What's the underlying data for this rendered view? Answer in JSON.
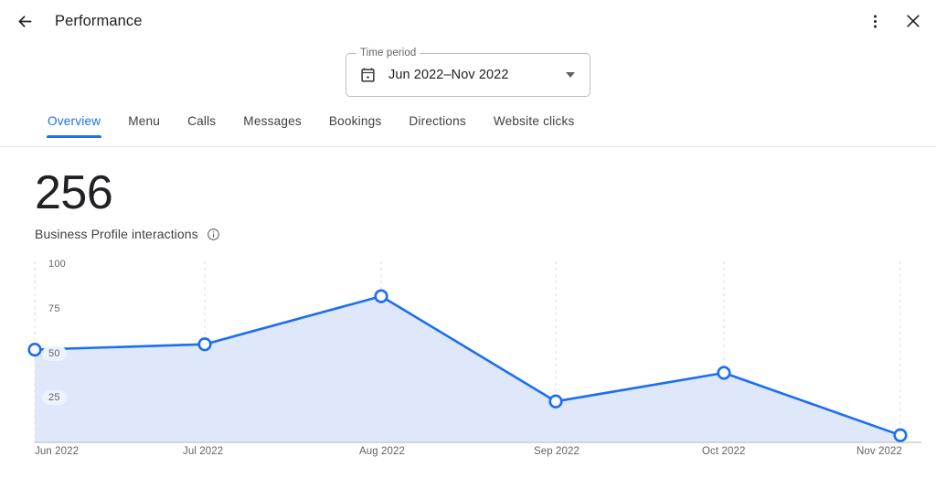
{
  "header": {
    "back_icon": "arrow-left-icon",
    "title": "Performance",
    "more_icon": "more-vertical-icon",
    "close_icon": "close-icon"
  },
  "time_period": {
    "legend": "Time period",
    "value": "Jun 2022–Nov 2022",
    "calendar_icon": "calendar-icon",
    "dropdown_icon": "chevron-down-icon"
  },
  "tabs": [
    {
      "label": "Overview",
      "active": true
    },
    {
      "label": "Menu",
      "active": false
    },
    {
      "label": "Calls",
      "active": false
    },
    {
      "label": "Messages",
      "active": false
    },
    {
      "label": "Bookings",
      "active": false
    },
    {
      "label": "Directions",
      "active": false
    },
    {
      "label": "Website clicks",
      "active": false
    }
  ],
  "metric": {
    "value": "256",
    "label": "Business Profile interactions",
    "info_icon": "info-circle-icon"
  },
  "colors": {
    "accent": "#1a73e8",
    "line": "#1b6ef3",
    "fill": "#dfe8fb",
    "grid": "#dadce0",
    "text_secondary": "#5f6368",
    "tick_pill": "#eef2fd"
  },
  "chart_data": {
    "type": "area",
    "title": "Business Profile interactions",
    "xlabel": "",
    "ylabel": "",
    "categories": [
      "Jun 2022",
      "Jul 2022",
      "Aug 2022",
      "Sep 2022",
      "Oct 2022",
      "Nov 2022"
    ],
    "values": [
      52,
      55,
      82,
      23,
      39,
      4
    ],
    "ylim": [
      0,
      100
    ],
    "yticks": [
      100,
      75,
      50,
      25
    ],
    "grid": "vertical-dashed",
    "legend": "none",
    "markers": true,
    "series": [
      {
        "name": "Business Profile interactions",
        "values": [
          52,
          55,
          82,
          23,
          39,
          4
        ]
      }
    ]
  }
}
